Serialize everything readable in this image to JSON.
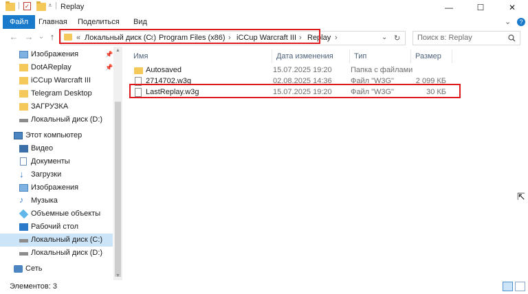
{
  "window": {
    "title": "Replay",
    "minimize": "—",
    "maximize": "☐",
    "close": "✕"
  },
  "ribbon": {
    "tabs": [
      "Файл",
      "Главная",
      "Поделиться",
      "Вид"
    ],
    "collapse": "⌄",
    "help": "?"
  },
  "address": {
    "back": "←",
    "forward": "→",
    "recent": "⌄",
    "up": "↑",
    "prefix": "«",
    "crumbs": [
      "Локальный диск (C:)",
      "Program Files (x86)",
      "iCCup Warcraft III",
      "Replay"
    ],
    "separator": "›",
    "dropdown": "⌄",
    "refresh": "↻"
  },
  "search": {
    "placeholder": "Поиск в: Replay"
  },
  "nav": {
    "items": [
      {
        "label": "Изображения",
        "icon": "pictures-icon",
        "pinned": true
      },
      {
        "label": "DotAReplay",
        "icon": "folder-icon",
        "pinned": true
      },
      {
        "label": "iCCup Warcraft III",
        "icon": "folder-icon"
      },
      {
        "label": "Telegram Desktop",
        "icon": "folder-icon"
      },
      {
        "label": "ЗАГРУЗКА",
        "icon": "folder-icon"
      },
      {
        "label": "Локальный диск (D:)",
        "icon": "drive-icon"
      },
      {
        "label": "Этот компьютер",
        "icon": "computer-icon"
      },
      {
        "label": "Видео",
        "icon": "video-icon"
      },
      {
        "label": "Документы",
        "icon": "documents-icon"
      },
      {
        "label": "Загрузки",
        "icon": "downloads-icon"
      },
      {
        "label": "Изображения",
        "icon": "pictures-icon"
      },
      {
        "label": "Музыка",
        "icon": "music-icon"
      },
      {
        "label": "Объемные объекты",
        "icon": "3d-objects-icon"
      },
      {
        "label": "Рабочий стол",
        "icon": "desktop-icon"
      },
      {
        "label": "Локальный диск (C:)",
        "icon": "drive-icon",
        "selected": true
      },
      {
        "label": "Локальный диск (D:)",
        "icon": "drive-icon"
      },
      {
        "label": "Сеть",
        "icon": "network-icon"
      }
    ]
  },
  "columns": [
    "Имя",
    "Дата изменения",
    "Тип",
    "Размер"
  ],
  "files": [
    {
      "name": "Autosaved",
      "date": "15.07.2025 19:20",
      "type": "Папка с файлами",
      "size": "",
      "kind": "folder"
    },
    {
      "name": "2714702.w3g",
      "date": "02.08.2025 14:36",
      "type": "Файл \"W3G\"",
      "size": "2 099 КБ",
      "kind": "file"
    },
    {
      "name": "LastReplay.w3g",
      "date": "15.07.2025 19:20",
      "type": "Файл \"W3G\"",
      "size": "30 КБ",
      "kind": "file"
    }
  ],
  "status": {
    "count": "Элементов: 3"
  },
  "colors": {
    "accent": "#1979ca",
    "highlight": "#e0181b",
    "selection": "#cce4f7"
  }
}
